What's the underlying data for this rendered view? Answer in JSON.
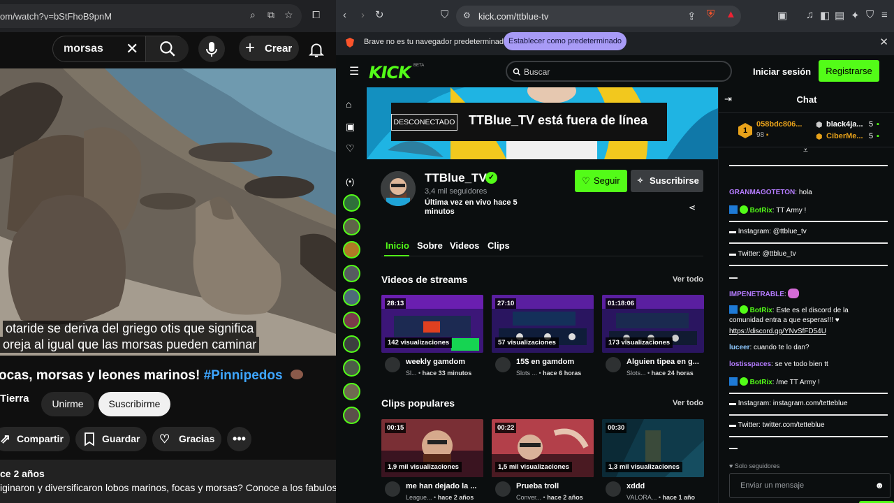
{
  "youtube": {
    "url": "om/watch?v=bStFhoB9pnM",
    "search_query": "morsas",
    "create_label": "Crear",
    "captions": [
      "otaride se deriva del griego otis que significa",
      "oreja al igual que las morsas pueden caminar"
    ],
    "title": "ocas, morsas y leones marinos! ",
    "title_tag": "#Pinnipedos",
    "channel": "Tierra",
    "join_label": "Unirme",
    "subscribe_label": "Suscribirme",
    "share_label": "Compartir",
    "save_label": "Guardar",
    "thanks_label": "Gracias",
    "desc_age": "ce 2 años",
    "desc_text": "iginaron y diversificaron lobos marinos, focas y morsas? Conoce a los fabulosos"
  },
  "browser": {
    "url": "kick.com/ttblue-tv",
    "info_message": "Brave no es tu navegador predeterminado",
    "info_button": "Establecer como predeterminado"
  },
  "kick": {
    "logo": "KICK",
    "logo_badge": "BETA",
    "search_placeholder": "Buscar",
    "login_label": "Iniciar sesión",
    "register_label": "Registrarse",
    "offline_badge": "DESCONECTADO",
    "offline_title": "TTBlue_TV está fuera de línea",
    "channel_name": "TTBlue_TV",
    "followers": "3,4 mil seguidores",
    "last_live": "Última vez en vivo hace 5 minutos",
    "follow_label": "Seguir",
    "subscribe_label": "Suscribirse",
    "tabs": [
      "Inicio",
      "Sobre",
      "Videos",
      "Clips"
    ],
    "streams_heading": "Videos de streams",
    "clips_heading": "Clips populares",
    "see_all": "Ver todo",
    "streams": [
      {
        "duration": "28:13",
        "views": "142 visualizaciones",
        "title": "weekly gamdom",
        "category": "Sl...",
        "age": "hace 33 minutos"
      },
      {
        "duration": "27:10",
        "views": "57 visualizaciones",
        "title": "15$ en gamdom",
        "category": "Slots ...",
        "age": "hace 6 horas"
      },
      {
        "duration": "01:18:06",
        "views": "173 visualizaciones",
        "title": "Alguien tipea en g...",
        "category": "Slots...",
        "age": "hace 24 horas"
      }
    ],
    "clips": [
      {
        "duration": "00:15",
        "views": "1,9 mil visualizaciones",
        "title": "me han dejado la ...",
        "category": "League...",
        "age": "hace 2 años"
      },
      {
        "duration": "00:22",
        "views": "1,5 mil visualizaciones",
        "title": "Prueba troll",
        "category": "Conver...",
        "age": "hace 2 años"
      },
      {
        "duration": "00:30",
        "views": "1,3 mil visualizaciones",
        "title": "xddd",
        "category": "VALORA...",
        "age": "hace 1 año"
      }
    ]
  },
  "chat": {
    "title": "Chat",
    "top_rank": "1",
    "top_user": "058bdc806...",
    "top_count": "98",
    "gifters": [
      {
        "name": "black4ja...",
        "count": "5"
      },
      {
        "name": "CiberMe...",
        "count": "5"
      }
    ],
    "messages": [
      {
        "user": "GRANMAGOTETON",
        "text": "hola",
        "color": "#b57cff"
      },
      {
        "user": "BotRix",
        "text": "TT Army !",
        "color": "#53fc18"
      },
      {
        "user": "",
        "text": "Instagram: @ttblue_tv",
        "color": ""
      },
      {
        "user": "",
        "text": "Twitter: @ttblue_tv",
        "color": ""
      },
      {
        "user": "IMPENETRABLE",
        "text": "",
        "color": "#b57cff"
      },
      {
        "user": "BotRix",
        "text": "Este es el discord de la",
        "color": "#53fc18"
      },
      {
        "user": "",
        "text": "comunidad entra a que esperas!!! ♥",
        "color": ""
      },
      {
        "user": "",
        "text": "https://discord.gg/YNvSfFD54U",
        "color": ""
      },
      {
        "user": "luceer",
        "text": "cuando te lo dan?",
        "color": "#8ec8ff"
      },
      {
        "user": "lostisspaces",
        "text": "se ve todo bien tt",
        "color": "#b57cff"
      },
      {
        "user": "BotRix",
        "text": "/me TT Army !",
        "color": "#53fc18"
      },
      {
        "user": "",
        "text": "Instagram: instagram.com/tetteblue",
        "color": ""
      },
      {
        "user": "",
        "text": "Twitter: twitter.com/tetteblue",
        "color": ""
      }
    ],
    "followers_only": "Solo seguidores",
    "input_placeholder": "Enviar un mensaje"
  },
  "colors": {
    "kick_green": "#53fc18",
    "yt_link": "#3ea6ff",
    "brave_button": "#a89bf6"
  }
}
